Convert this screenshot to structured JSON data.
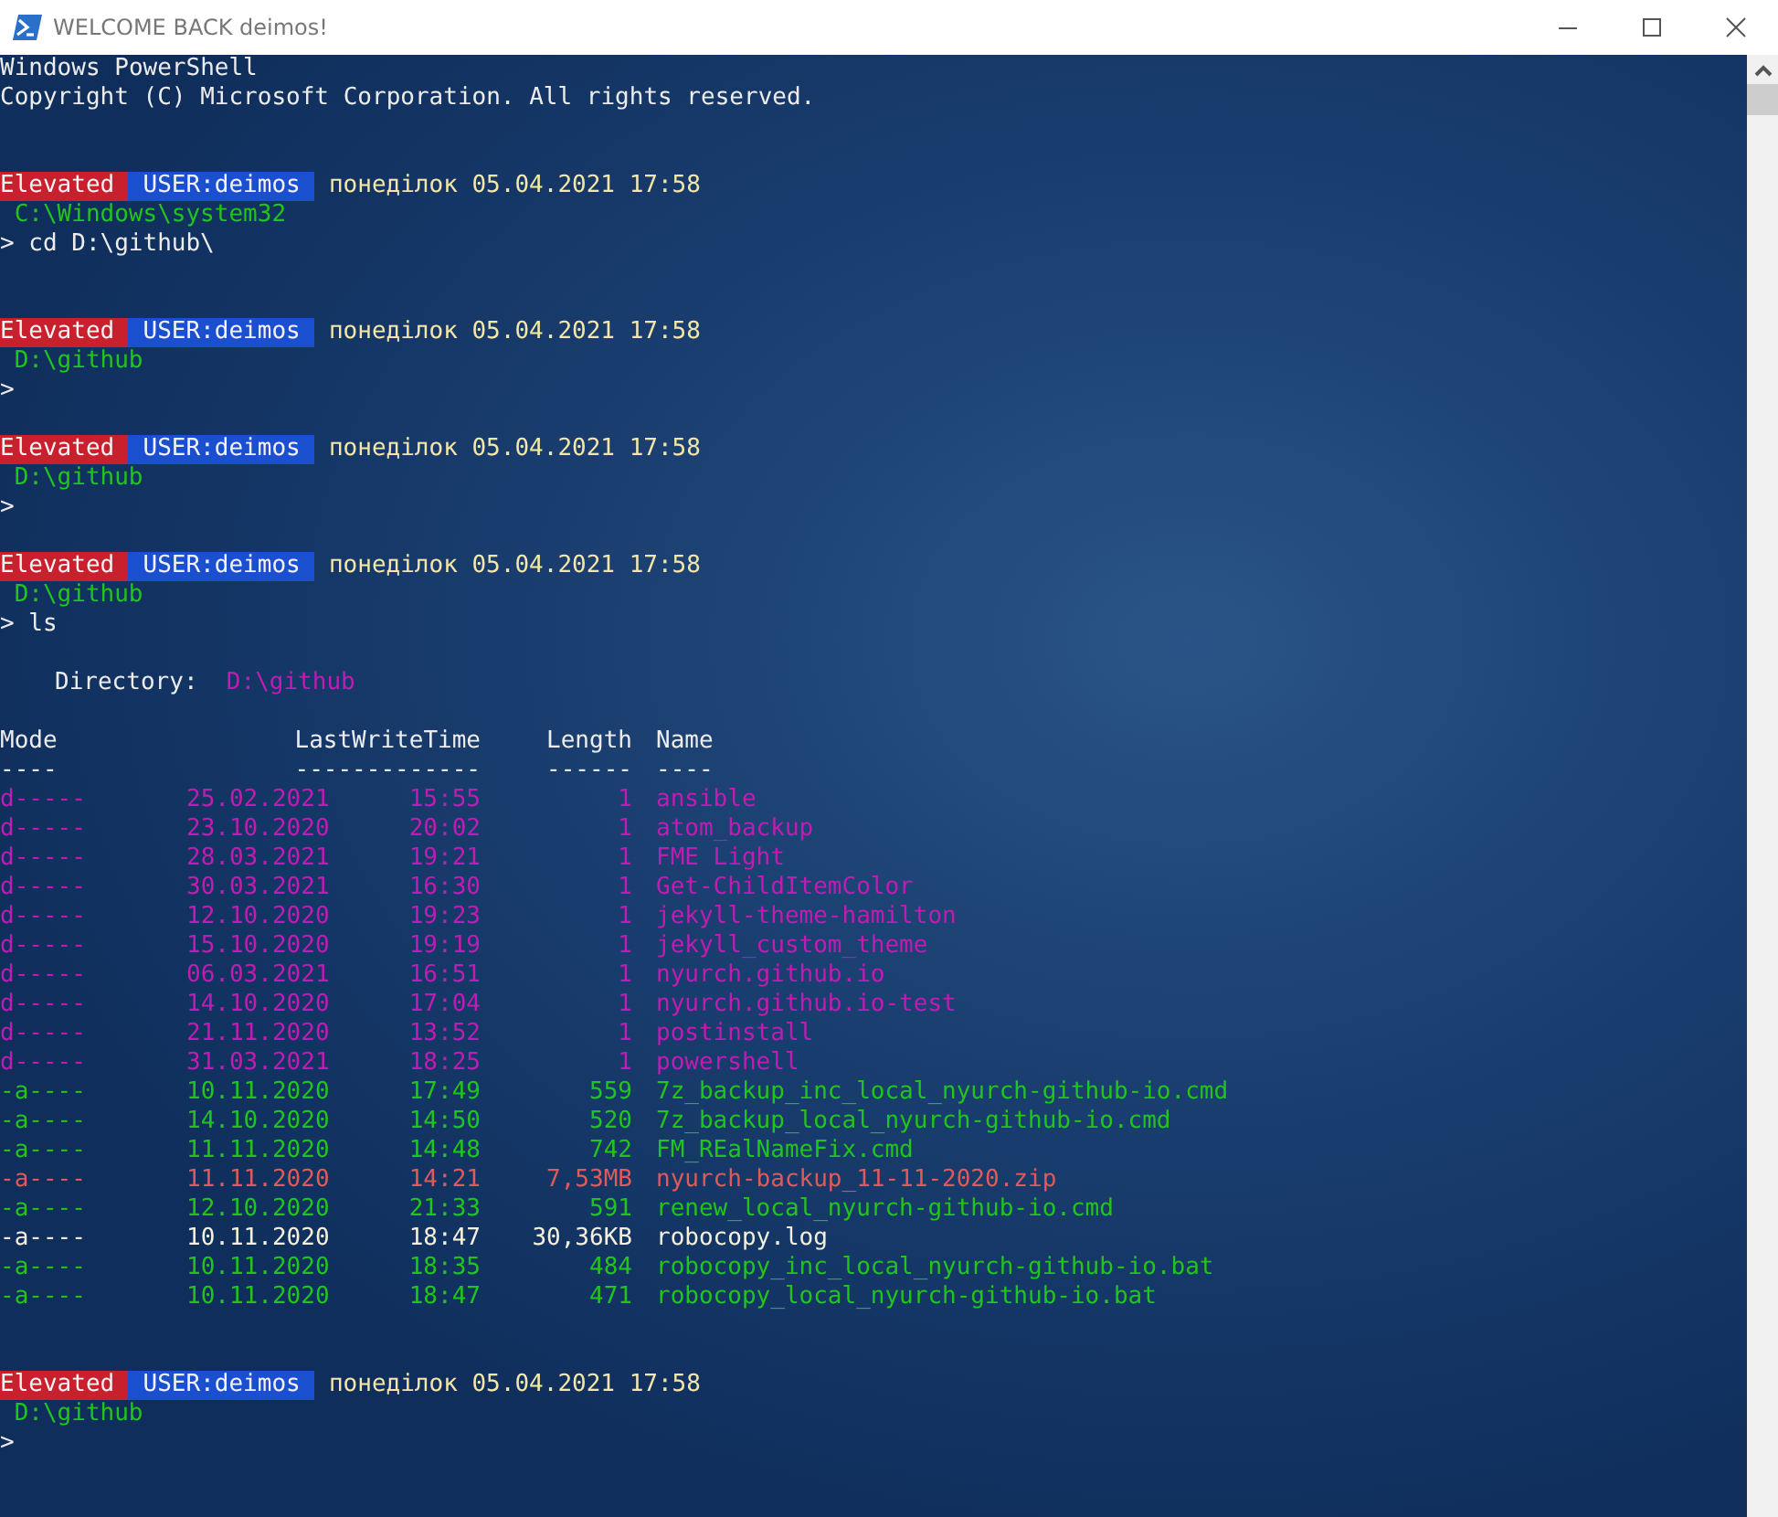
{
  "window": {
    "title": "WELCOME BACK deimos!"
  },
  "lines": [
    {
      "kind": "text",
      "text": "Windows PowerShell"
    },
    {
      "kind": "text",
      "text": "Copyright (C) Microsoft Corporation. All rights reserved."
    },
    {
      "kind": "blank"
    },
    {
      "kind": "blank"
    },
    {
      "kind": "prompt",
      "elevated": "Elevated",
      "user": "USER:deimos",
      "datetime": "понеділок 05.04.2021 17:58"
    },
    {
      "kind": "path",
      "text": "C:\\Windows\\system32"
    },
    {
      "kind": "command",
      "prompt": ">",
      "text": "cd D:\\github\\"
    },
    {
      "kind": "blank"
    },
    {
      "kind": "blank"
    },
    {
      "kind": "prompt",
      "elevated": "Elevated",
      "user": "USER:deimos",
      "datetime": "понеділок 05.04.2021 17:58"
    },
    {
      "kind": "path",
      "text": "D:\\github"
    },
    {
      "kind": "command",
      "prompt": ">"
    },
    {
      "kind": "blank"
    },
    {
      "kind": "prompt",
      "elevated": "Elevated",
      "user": "USER:deimos",
      "datetime": "понеділок 05.04.2021 17:58"
    },
    {
      "kind": "path",
      "text": "D:\\github"
    },
    {
      "kind": "command",
      "prompt": ">"
    },
    {
      "kind": "blank"
    },
    {
      "kind": "prompt",
      "elevated": "Elevated",
      "user": "USER:deimos",
      "datetime": "понеділок 05.04.2021 17:58"
    },
    {
      "kind": "path",
      "text": "D:\\github"
    },
    {
      "kind": "command",
      "prompt": ">",
      "text": "ls"
    },
    {
      "kind": "blank"
    },
    {
      "kind": "directory",
      "label": "Directory:",
      "path": "D:\\github"
    },
    {
      "kind": "blank"
    },
    {
      "kind": "columns",
      "cells": [
        "Mode",
        "LastWriteTime",
        "Length",
        "Name"
      ]
    },
    {
      "kind": "rule",
      "cells": [
        "----",
        "-------------",
        "------",
        "----"
      ]
    },
    {
      "kind": "file",
      "mode": "d-----",
      "date": "25.02.2021",
      "time": "15:55",
      "length": "1",
      "name": "ansible",
      "color": "#c01cb4"
    },
    {
      "kind": "file",
      "mode": "d-----",
      "date": "23.10.2020",
      "time": "20:02",
      "length": "1",
      "name": "atom_backup",
      "color": "#c01cb4"
    },
    {
      "kind": "file",
      "mode": "d-----",
      "date": "28.03.2021",
      "time": "19:21",
      "length": "1",
      "name": "FME Light",
      "color": "#c01cb4"
    },
    {
      "kind": "file",
      "mode": "d-----",
      "date": "30.03.2021",
      "time": "16:30",
      "length": "1",
      "name": "Get-ChildItemColor",
      "color": "#c01cb4"
    },
    {
      "kind": "file",
      "mode": "d-----",
      "date": "12.10.2020",
      "time": "19:23",
      "length": "1",
      "name": "jekyll-theme-hamilton",
      "color": "#c01cb4"
    },
    {
      "kind": "file",
      "mode": "d-----",
      "date": "15.10.2020",
      "time": "19:19",
      "length": "1",
      "name": "jekyll_custom_theme",
      "color": "#c01cb4"
    },
    {
      "kind": "file",
      "mode": "d-----",
      "date": "06.03.2021",
      "time": "16:51",
      "length": "1",
      "name": "nyurch.github.io",
      "color": "#c01cb4"
    },
    {
      "kind": "file",
      "mode": "d-----",
      "date": "14.10.2020",
      "time": "17:04",
      "length": "1",
      "name": "nyurch.github.io-test",
      "color": "#c01cb4"
    },
    {
      "kind": "file",
      "mode": "d-----",
      "date": "21.11.2020",
      "time": "13:52",
      "length": "1",
      "name": "postinstall",
      "color": "#c01cb4"
    },
    {
      "kind": "file",
      "mode": "d-----",
      "date": "31.03.2021",
      "time": "18:25",
      "length": "1",
      "name": "powershell",
      "color": "#c01cb4"
    },
    {
      "kind": "file",
      "mode": "-a----",
      "date": "10.11.2020",
      "time": "17:49",
      "length": "559",
      "name": "7z_backup_inc_local_nyurch-github-io.cmd",
      "color": "#22c41c"
    },
    {
      "kind": "file",
      "mode": "-a----",
      "date": "14.10.2020",
      "time": "14:50",
      "length": "520",
      "name": "7z_backup_local_nyurch-github-io.cmd",
      "color": "#22c41c"
    },
    {
      "kind": "file",
      "mode": "-a----",
      "date": "11.11.2020",
      "time": "14:48",
      "length": "742",
      "name": "FM_REalNameFix.cmd",
      "color": "#22c41c"
    },
    {
      "kind": "file",
      "mode": "-a----",
      "date": "11.11.2020",
      "time": "14:21",
      "length": "7,53MB",
      "name": "nyurch-backup_11-11-2020.zip",
      "color": "#e05a5a"
    },
    {
      "kind": "file",
      "mode": "-a----",
      "date": "12.10.2020",
      "time": "21:33",
      "length": "591",
      "name": "renew_local_nyurch-github-io.cmd",
      "color": "#22c41c"
    },
    {
      "kind": "file",
      "mode": "-a----",
      "date": "10.11.2020",
      "time": "18:47",
      "length": "30,36KB",
      "name": "robocopy.log",
      "color": "#f4f0dc"
    },
    {
      "kind": "file",
      "mode": "-a----",
      "date": "10.11.2020",
      "time": "18:35",
      "length": "484",
      "name": "robocopy_inc_local_nyurch-github-io.bat",
      "color": "#22c41c"
    },
    {
      "kind": "file",
      "mode": "-a----",
      "date": "10.11.2020",
      "time": "18:47",
      "length": "471",
      "name": "robocopy_local_nyurch-github-io.bat",
      "color": "#22c41c"
    },
    {
      "kind": "blank"
    },
    {
      "kind": "blank"
    },
    {
      "kind": "prompt",
      "elevated": "Elevated",
      "user": "USER:deimos",
      "datetime": "понеділок 05.04.2021 17:58"
    },
    {
      "kind": "path",
      "text": "D:\\github"
    },
    {
      "kind": "command",
      "prompt": ">"
    }
  ]
}
